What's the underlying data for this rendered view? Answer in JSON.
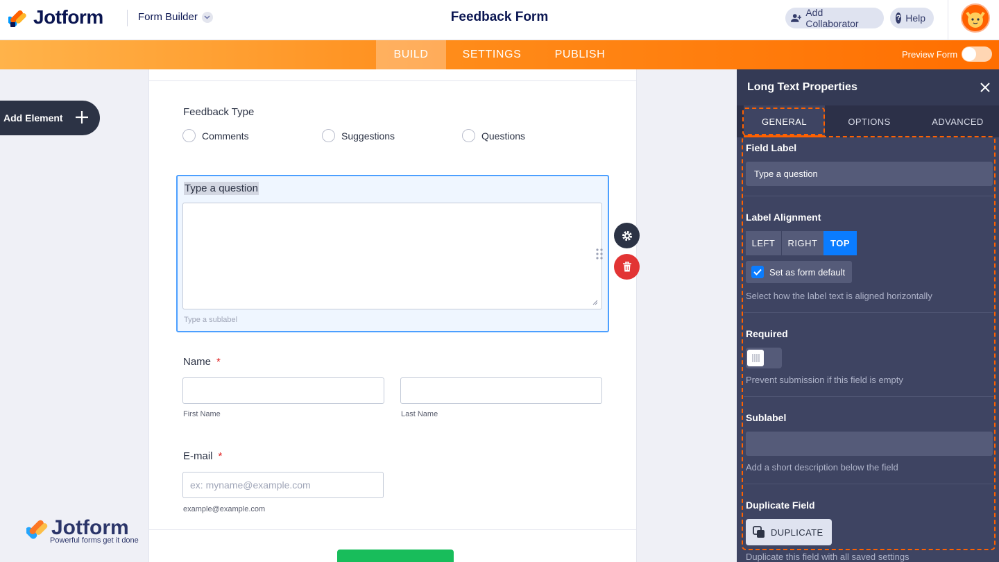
{
  "header": {
    "brand": "Jotform",
    "builder_menu": "Form Builder",
    "form_title": "Feedback Form",
    "add_collaborator": "Add Collaborator",
    "help": "Help"
  },
  "nav": {
    "build": "BUILD",
    "settings": "SETTINGS",
    "publish": "PUBLISH",
    "preview_form": "Preview Form",
    "preview_enabled": false
  },
  "sidebar": {
    "add_element": "Add Element"
  },
  "watermark": {
    "brand": "Jotform",
    "tagline": "Powerful forms get it done"
  },
  "form": {
    "feedback_type": {
      "label": "Feedback Type",
      "options": [
        "Comments",
        "Suggestions",
        "Questions"
      ]
    },
    "long_text": {
      "label": "Type a question",
      "sublabel_placeholder": "Type a sublabel"
    },
    "name": {
      "label": "Name",
      "required_mark": "*",
      "first_sub": "First Name",
      "last_sub": "Last Name"
    },
    "email": {
      "label": "E-mail",
      "required_mark": "*",
      "placeholder": "ex: myname@example.com",
      "sublabel": "example@example.com"
    }
  },
  "panel": {
    "title": "Long Text Properties",
    "tabs": [
      "GENERAL",
      "OPTIONS",
      "ADVANCED"
    ],
    "active_tab": "GENERAL",
    "field_label": {
      "title": "Field Label",
      "value": "Type a question"
    },
    "label_alignment": {
      "title": "Label Alignment",
      "options": [
        "LEFT",
        "RIGHT",
        "TOP"
      ],
      "selected": "TOP",
      "default_checkbox": "Set as form default",
      "default_checked": true,
      "description": "Select how the label text is aligned horizontally"
    },
    "required": {
      "title": "Required",
      "enabled": false,
      "description": "Prevent submission if this field is empty"
    },
    "sublabel": {
      "title": "Sublabel",
      "value": "",
      "description": "Add a short description below the field"
    },
    "duplicate": {
      "title": "Duplicate Field",
      "button": "DUPLICATE",
      "description": "Duplicate this field with all saved settings"
    }
  },
  "colors": {
    "brand_navy": "#0a1551",
    "orange": "#ff6100",
    "selection_blue": "#4c9fff",
    "active_blue": "#0a7cff",
    "delete_red": "#e23434",
    "submit_green": "#18bd5b",
    "panel_bg": "#3e4462"
  }
}
